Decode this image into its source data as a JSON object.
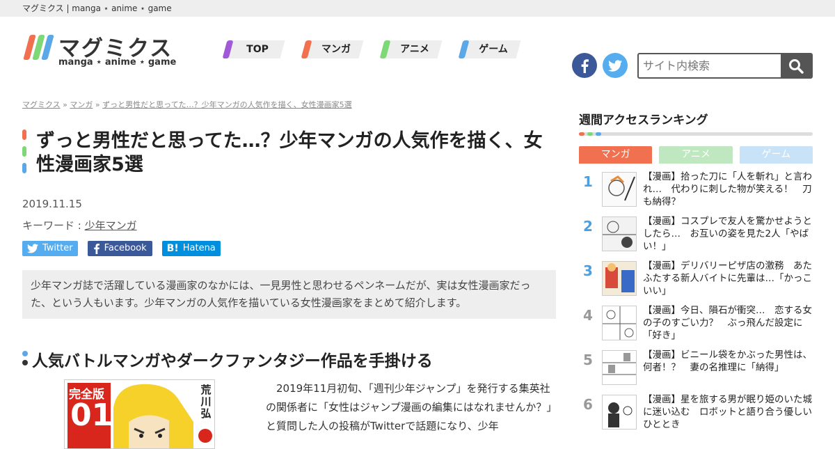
{
  "topbar": {
    "text": "マグミクス | manga ⋆ anime ⋆ game"
  },
  "logo": {
    "title": "マグミクス",
    "subtitle": "manga ⋆ anime ⋆ game"
  },
  "nav": [
    {
      "label": "TOP",
      "color": "#a05ad8"
    },
    {
      "label": "マンガ",
      "color": "#f07050"
    },
    {
      "label": "アニメ",
      "color": "#7fd878"
    },
    {
      "label": "ゲーム",
      "color": "#5aa8e8"
    }
  ],
  "social": {
    "facebook_icon": "facebook-icon",
    "twitter_icon": "twitter-icon",
    "facebook_color": "#3b5998",
    "twitter_color": "#55acee"
  },
  "search": {
    "placeholder": "サイト内検索",
    "button_icon": "search-icon"
  },
  "breadcrumb": {
    "home": "マグミクス",
    "sep1": " » ",
    "category": "マンガ",
    "sep2": " » ",
    "current": "ずっと男性だと思ってた…？少年マンガの人気作を描く、女性漫画家5選"
  },
  "article": {
    "title": "ずっと男性だと思ってた…？少年マンガの人気作を描く、女性漫画家5選",
    "date": "2019.11.15",
    "keyword_label": "キーワード : ",
    "keyword": "少年マンガ",
    "share": {
      "twitter": "Twitter",
      "facebook": "Facebook",
      "hatena": "Hatena",
      "hatena_mark": "B!"
    },
    "lead": "少年マンガ誌で活躍している漫画家のなかには、一見男性と思わせるペンネームだが、実は女性漫画家だった、という人もいます。少年マンガの人気作を描いている女性漫画家をまとめて紹介します。",
    "heading": "人気バトルマンガやダークファンタジー作品を手掛ける",
    "cover": {
      "badge": "完全版",
      "vol": "01",
      "author": "荒川弘"
    },
    "body": "2019年11月初旬、「週刊少年ジャンプ」を発行する集英社の関係者に「女性はジャンプ漫画の編集にはなれませんか？」と質問した人の投稿がTwitterで話題になり、少年"
  },
  "sidebar": {
    "title": "週間アクセスランキング",
    "tabs": [
      {
        "label": "マンガ",
        "color": "#f07050"
      },
      {
        "label": "アニメ",
        "color": "#bfe8c0"
      },
      {
        "label": "ゲーム",
        "color": "#c8e2f8"
      }
    ],
    "ranking": [
      {
        "num": "1",
        "text": "【漫画】拾った刀に「人を斬れ」と言われ…　代わりに刺した物が笑える！　刀も納得？",
        "color": "#4aa0e0"
      },
      {
        "num": "2",
        "text": "【漫画】コスプレで友人を驚かせようとしたら…　お互いの姿を見た2人「やばい！」",
        "color": "#4aa0e0"
      },
      {
        "num": "3",
        "text": "【漫画】デリバリーピザ店の激務　あたふたする新人バイトに先輩は…「かっこいい」",
        "color": "#4aa0e0"
      },
      {
        "num": "4",
        "text": "【漫画】今日、隕石が衝突…　恋する女の子のすごい力？　ぶっ飛んだ設定に「好き」",
        "color": "#999999"
      },
      {
        "num": "5",
        "text": "【漫画】ビニール袋をかぶった男性は、何者！？　妻の名推理に「納得」",
        "color": "#999999"
      },
      {
        "num": "6",
        "text": "【漫画】星を旅する男が眠り姫のいた城に迷い込む　ロボットと語り合う優しいひととき",
        "color": "#999999"
      }
    ]
  }
}
